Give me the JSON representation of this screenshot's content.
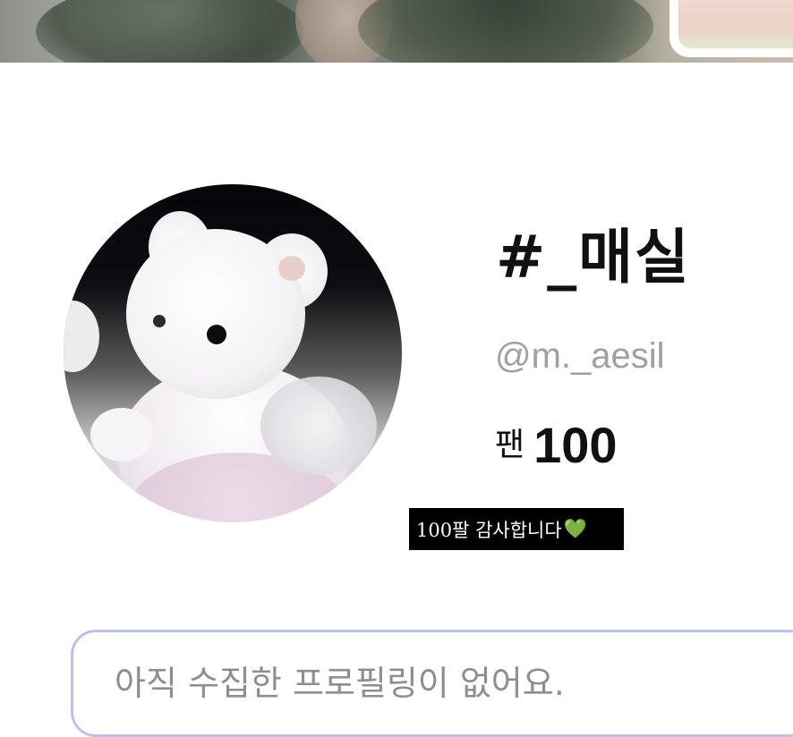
{
  "profile": {
    "display_name": "#_매실",
    "handle": "@m._aesil",
    "fans_label": "팬",
    "fans_count": "100",
    "caption": "100팔 감사합니다",
    "caption_emoji": "💚"
  },
  "collection": {
    "empty_message": "아직 수집한 프로필링이 없어요."
  },
  "colors": {
    "caption_bg": "#000000",
    "empty_box_border": "#b9c2ee",
    "handle_text": "#a0a0a0"
  }
}
